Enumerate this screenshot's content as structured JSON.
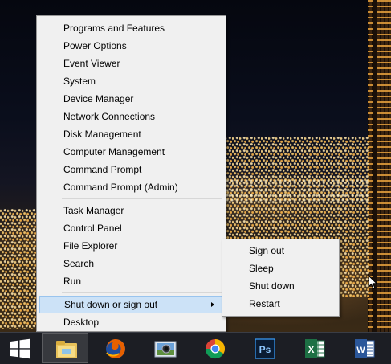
{
  "winx_menu": {
    "group1": [
      "Programs and Features",
      "Power Options",
      "Event Viewer",
      "System",
      "Device Manager",
      "Network Connections",
      "Disk Management",
      "Computer Management",
      "Command Prompt",
      "Command Prompt (Admin)"
    ],
    "group2": [
      "Task Manager",
      "Control Panel",
      "File Explorer",
      "Search",
      "Run"
    ],
    "shutdown": "Shut down or sign out",
    "desktop": "Desktop"
  },
  "submenu": {
    "items": [
      "Sign out",
      "Sleep",
      "Shut down",
      "Restart"
    ]
  },
  "taskbar": {
    "apps": [
      {
        "name": "start-button",
        "icon": "windows-logo-icon"
      },
      {
        "name": "file-explorer",
        "icon": "folder-icon"
      },
      {
        "name": "firefox",
        "icon": "firefox-icon"
      },
      {
        "name": "photo-viewer",
        "icon": "photo-camera-icon"
      },
      {
        "name": "chrome",
        "icon": "chrome-icon"
      },
      {
        "name": "photoshop",
        "icon": "photoshop-icon",
        "label": "Ps"
      },
      {
        "name": "excel",
        "icon": "excel-icon",
        "label": "X"
      },
      {
        "name": "word",
        "icon": "word-icon",
        "label": "W"
      }
    ]
  },
  "colors": {
    "menu_bg": "#f0f0f0",
    "highlight": "#cce2f7",
    "taskbar": "#1c1e24"
  }
}
